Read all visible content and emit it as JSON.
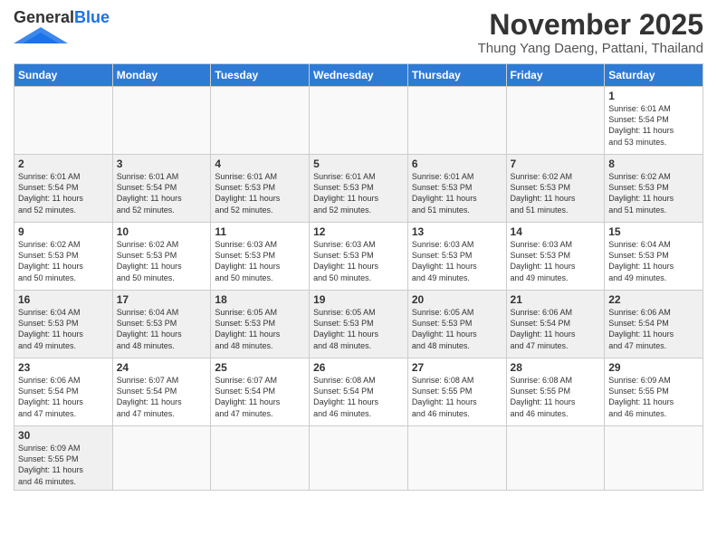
{
  "header": {
    "logo_general": "General",
    "logo_blue": "Blue",
    "month_title": "November 2025",
    "location": "Thung Yang Daeng, Pattani, Thailand"
  },
  "days_of_week": [
    "Sunday",
    "Monday",
    "Tuesday",
    "Wednesday",
    "Thursday",
    "Friday",
    "Saturday"
  ],
  "weeks": [
    {
      "cells": [
        {
          "day": null,
          "content": null
        },
        {
          "day": null,
          "content": null
        },
        {
          "day": null,
          "content": null
        },
        {
          "day": null,
          "content": null
        },
        {
          "day": null,
          "content": null
        },
        {
          "day": null,
          "content": null
        },
        {
          "day": "1",
          "content": "Sunrise: 6:01 AM\nSunset: 5:54 PM\nDaylight: 11 hours\nand 53 minutes."
        }
      ]
    },
    {
      "cells": [
        {
          "day": "2",
          "content": "Sunrise: 6:01 AM\nSunset: 5:54 PM\nDaylight: 11 hours\nand 52 minutes."
        },
        {
          "day": "3",
          "content": "Sunrise: 6:01 AM\nSunset: 5:54 PM\nDaylight: 11 hours\nand 52 minutes."
        },
        {
          "day": "4",
          "content": "Sunrise: 6:01 AM\nSunset: 5:53 PM\nDaylight: 11 hours\nand 52 minutes."
        },
        {
          "day": "5",
          "content": "Sunrise: 6:01 AM\nSunset: 5:53 PM\nDaylight: 11 hours\nand 52 minutes."
        },
        {
          "day": "6",
          "content": "Sunrise: 6:01 AM\nSunset: 5:53 PM\nDaylight: 11 hours\nand 51 minutes."
        },
        {
          "day": "7",
          "content": "Sunrise: 6:02 AM\nSunset: 5:53 PM\nDaylight: 11 hours\nand 51 minutes."
        },
        {
          "day": "8",
          "content": "Sunrise: 6:02 AM\nSunset: 5:53 PM\nDaylight: 11 hours\nand 51 minutes."
        }
      ]
    },
    {
      "cells": [
        {
          "day": "9",
          "content": "Sunrise: 6:02 AM\nSunset: 5:53 PM\nDaylight: 11 hours\nand 50 minutes."
        },
        {
          "day": "10",
          "content": "Sunrise: 6:02 AM\nSunset: 5:53 PM\nDaylight: 11 hours\nand 50 minutes."
        },
        {
          "day": "11",
          "content": "Sunrise: 6:03 AM\nSunset: 5:53 PM\nDaylight: 11 hours\nand 50 minutes."
        },
        {
          "day": "12",
          "content": "Sunrise: 6:03 AM\nSunset: 5:53 PM\nDaylight: 11 hours\nand 50 minutes."
        },
        {
          "day": "13",
          "content": "Sunrise: 6:03 AM\nSunset: 5:53 PM\nDaylight: 11 hours\nand 49 minutes."
        },
        {
          "day": "14",
          "content": "Sunrise: 6:03 AM\nSunset: 5:53 PM\nDaylight: 11 hours\nand 49 minutes."
        },
        {
          "day": "15",
          "content": "Sunrise: 6:04 AM\nSunset: 5:53 PM\nDaylight: 11 hours\nand 49 minutes."
        }
      ]
    },
    {
      "cells": [
        {
          "day": "16",
          "content": "Sunrise: 6:04 AM\nSunset: 5:53 PM\nDaylight: 11 hours\nand 49 minutes."
        },
        {
          "day": "17",
          "content": "Sunrise: 6:04 AM\nSunset: 5:53 PM\nDaylight: 11 hours\nand 48 minutes."
        },
        {
          "day": "18",
          "content": "Sunrise: 6:05 AM\nSunset: 5:53 PM\nDaylight: 11 hours\nand 48 minutes."
        },
        {
          "day": "19",
          "content": "Sunrise: 6:05 AM\nSunset: 5:53 PM\nDaylight: 11 hours\nand 48 minutes."
        },
        {
          "day": "20",
          "content": "Sunrise: 6:05 AM\nSunset: 5:53 PM\nDaylight: 11 hours\nand 48 minutes."
        },
        {
          "day": "21",
          "content": "Sunrise: 6:06 AM\nSunset: 5:54 PM\nDaylight: 11 hours\nand 47 minutes."
        },
        {
          "day": "22",
          "content": "Sunrise: 6:06 AM\nSunset: 5:54 PM\nDaylight: 11 hours\nand 47 minutes."
        }
      ]
    },
    {
      "cells": [
        {
          "day": "23",
          "content": "Sunrise: 6:06 AM\nSunset: 5:54 PM\nDaylight: 11 hours\nand 47 minutes."
        },
        {
          "day": "24",
          "content": "Sunrise: 6:07 AM\nSunset: 5:54 PM\nDaylight: 11 hours\nand 47 minutes."
        },
        {
          "day": "25",
          "content": "Sunrise: 6:07 AM\nSunset: 5:54 PM\nDaylight: 11 hours\nand 47 minutes."
        },
        {
          "day": "26",
          "content": "Sunrise: 6:08 AM\nSunset: 5:54 PM\nDaylight: 11 hours\nand 46 minutes."
        },
        {
          "day": "27",
          "content": "Sunrise: 6:08 AM\nSunset: 5:55 PM\nDaylight: 11 hours\nand 46 minutes."
        },
        {
          "day": "28",
          "content": "Sunrise: 6:08 AM\nSunset: 5:55 PM\nDaylight: 11 hours\nand 46 minutes."
        },
        {
          "day": "29",
          "content": "Sunrise: 6:09 AM\nSunset: 5:55 PM\nDaylight: 11 hours\nand 46 minutes."
        }
      ]
    },
    {
      "cells": [
        {
          "day": "30",
          "content": "Sunrise: 6:09 AM\nSunset: 5:55 PM\nDaylight: 11 hours\nand 46 minutes."
        },
        {
          "day": null,
          "content": null
        },
        {
          "day": null,
          "content": null
        },
        {
          "day": null,
          "content": null
        },
        {
          "day": null,
          "content": null
        },
        {
          "day": null,
          "content": null
        },
        {
          "day": null,
          "content": null
        }
      ]
    }
  ]
}
